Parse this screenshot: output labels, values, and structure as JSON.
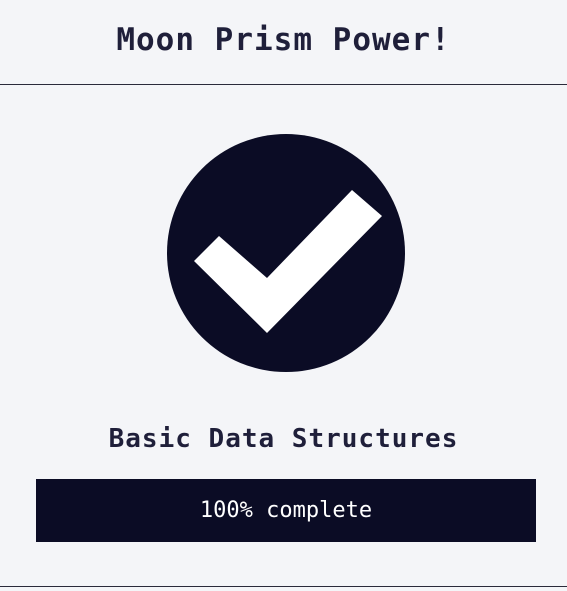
{
  "header": {
    "title": "Moon Prism Power!"
  },
  "status": {
    "icon": "checkmark-circle-icon",
    "icon_color": "#0b0c25",
    "check_color": "#ffffff"
  },
  "course": {
    "title": "Basic Data Structures",
    "progress_percent": 100,
    "progress_label": "100% complete"
  },
  "colors": {
    "background": "#f4f5f8",
    "accent": "#0b0c25",
    "text": "#1f1f3a"
  }
}
